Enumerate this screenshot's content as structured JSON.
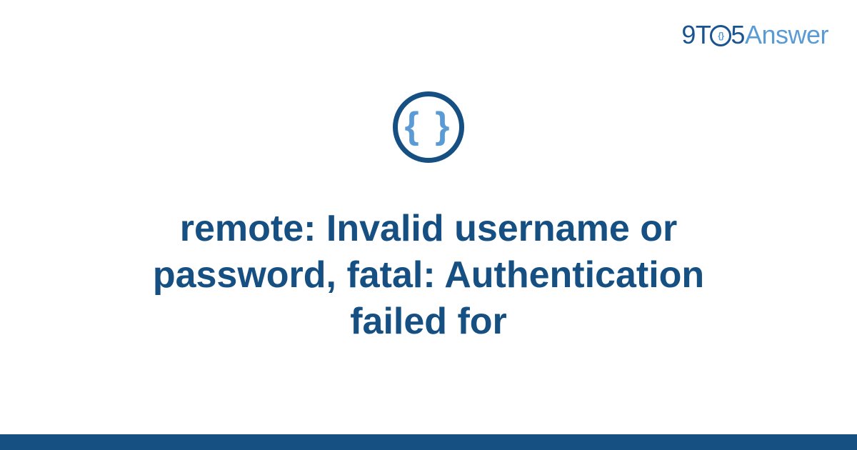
{
  "header": {
    "logo_part1": "9T",
    "logo_circle_text": "{}",
    "logo_part2": "5",
    "logo_part3": "Answer"
  },
  "icon": {
    "braces": "{ }"
  },
  "main": {
    "title": "remote: Invalid username or password, fatal: Authentication failed for"
  },
  "colors": {
    "primary_dark": "#164f82",
    "primary_light": "#5a9bd5"
  }
}
